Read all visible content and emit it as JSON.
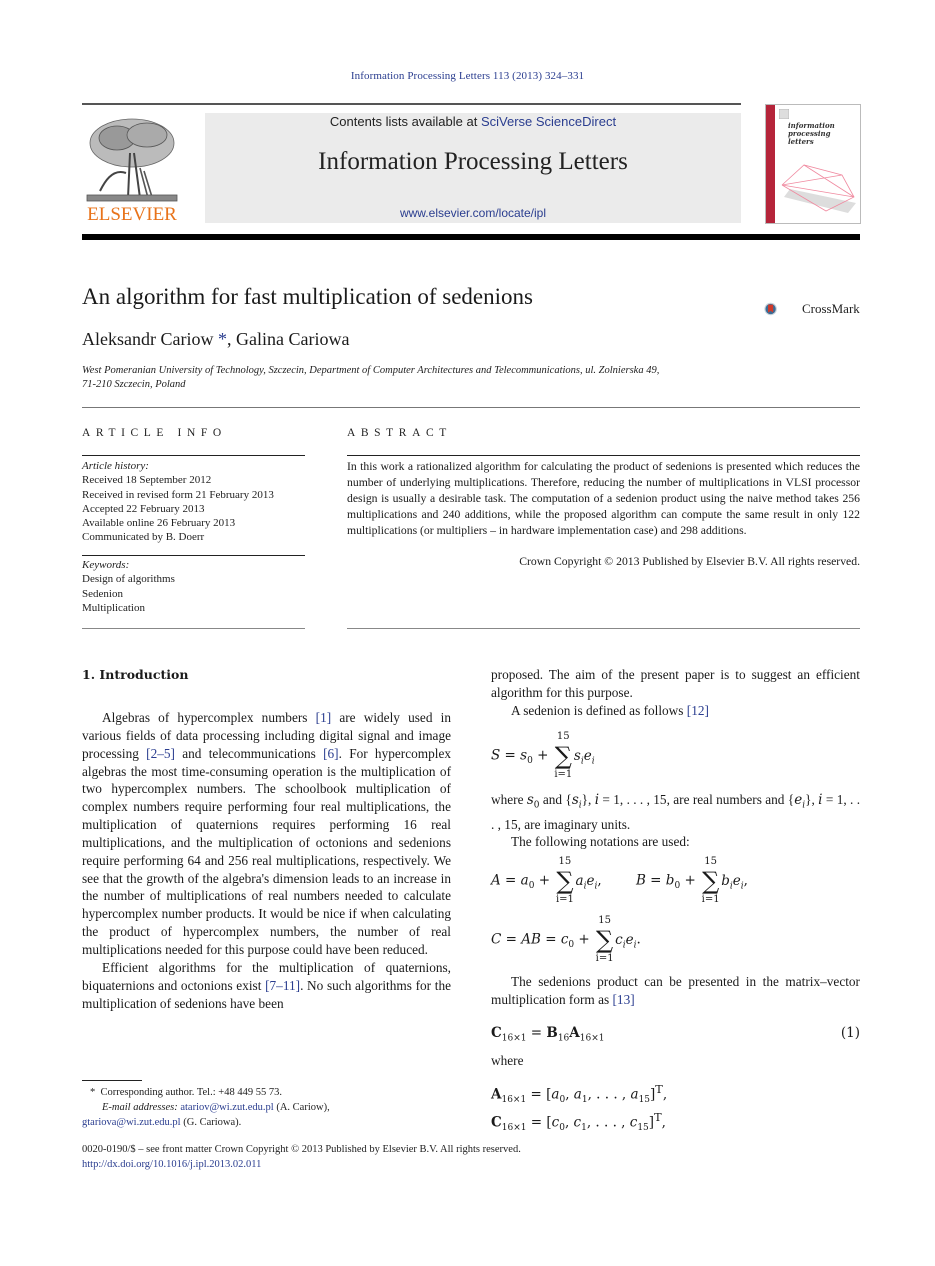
{
  "running_head": "Information Processing Letters 113 (2013) 324–331",
  "header": {
    "publisher_logo_text": "ELSEVIER",
    "contents_prefix": "Contents lists available at ",
    "contents_link": "SciVerse ScienceDirect",
    "journal_title": "Information Processing Letters",
    "journal_url": "www.elsevier.com/locate/ipl",
    "cover_title": [
      "information",
      "processing",
      "letters"
    ]
  },
  "colors": {
    "link": "#2a3d8f",
    "elsevier_orange": "#e8731a",
    "header_bg": "#ebebeb",
    "cover_spine": "#b5243a",
    "crossmark_red": "#d03a2a"
  },
  "article": {
    "title": "An algorithm for fast multiplication of sedenions",
    "crossmark_label": "CrossMark",
    "author_1": "Aleksandr Cariow",
    "author_star": "*",
    "author_sep": ", ",
    "author_2": "Galina Cariowa",
    "affiliation_line1": "West Pomeranian University of Technology, Szczecin, Department of Computer Architectures and Telecommunications, ul. Zolnierska 49,",
    "affiliation_line2": "71-210 Szczecin, Poland"
  },
  "article_info": {
    "heading": "ARTICLE INFO",
    "history_label": "Article history:",
    "history": [
      "Received 18 September 2012",
      "Received in revised form 21 February 2013",
      "Accepted 22 February 2013",
      "Available online 26 February 2013",
      "Communicated by B. Doerr"
    ],
    "keywords_label": "Keywords:",
    "keywords": [
      "Design of algorithms",
      "Sedenion",
      "Multiplication"
    ]
  },
  "abstract": {
    "heading": "ABSTRACT",
    "text": "In this work a rationalized algorithm for calculating the product of sedenions is presented which reduces the number of underlying multiplications. Therefore, reducing the number of multiplications in VLSI processor design is usually a desirable task. The computation of a sedenion product using the naive method takes 256 multiplications and 240 additions, while the proposed algorithm can compute the same result in only 122 multiplications (or multipliers – in hardware implementation case) and 298 additions.",
    "copyright": "Crown Copyright © 2013 Published by Elsevier B.V. All rights reserved."
  },
  "section": {
    "heading": "1.  Introduction",
    "p1": {
      "t1": "Algebras of hypercomplex numbers ",
      "r1": "[1]",
      "t2": " are widely used in various fields of data processing including digital signal and image processing ",
      "r2": "[2–5]",
      "t3": " and telecommunications ",
      "r3": "[6]",
      "t4": ". For hypercomplex algebras the most time-consuming operation is the multiplication of two hypercomplex numbers. The schoolbook multiplication of complex numbers require performing four real multiplications, the multiplication of quaternions requires performing 16 real multiplications, and the multiplication of octonions and sedenions require performing 64 and 256 real multiplications, respectively. We see that the growth of the algebra's dimension leads to an increase in the number of multiplications of real numbers needed to calculate hypercomplex number products. It would be nice if when calculating the product of hypercomplex numbers, the number of real multiplications needed for this purpose could have been reduced."
    },
    "p2": {
      "t1": "Efficient algorithms for the multiplication of quaternions, biquaternions and octonions exist ",
      "r1": "[7–11]",
      "t2": ". No such algorithms for the multiplication of sedenions have been"
    },
    "right_p1": "proposed. The aim of the present paper is to suggest an efficient algorithm for this purpose.",
    "right_p2": {
      "t1": "A sedenion is defined as follows ",
      "r1": "[12]"
    },
    "where_text": {
      "t1": "where ",
      "t2": " and {",
      "t3": "}, ",
      "t4": " = 1, . . . , 15, are real numbers and {",
      "t5": "}, ",
      "t6": " = 1, . . . , 15, are imaginary units."
    },
    "notations": "The following notations are used:",
    "product_text": {
      "t1": "The sedenions product can be presented in the matrix–vector multiplication form as ",
      "r1": "[13]"
    },
    "eq1_number": "(1)",
    "where2": "where",
    "sum_upper": "15",
    "sum_lower": "i=1"
  },
  "footnote": {
    "star": "*",
    "corresponding": "Corresponding author. Tel.: +48 449 55 73.",
    "email_label": "E-mail addresses: ",
    "email_1": "atariov@wi.zut.edu.pl",
    "email_1_owner": " (A. Cariow),",
    "email_2": "gtariova@wi.zut.edu.pl",
    "email_2_owner": " (G. Cariowa)."
  },
  "front_matter": {
    "line1": "0020-0190/$ – see front matter  Crown Copyright © 2013 Published by Elsevier B.V. All rights reserved.",
    "doi": "http://dx.doi.org/10.1016/j.ipl.2013.02.011"
  }
}
